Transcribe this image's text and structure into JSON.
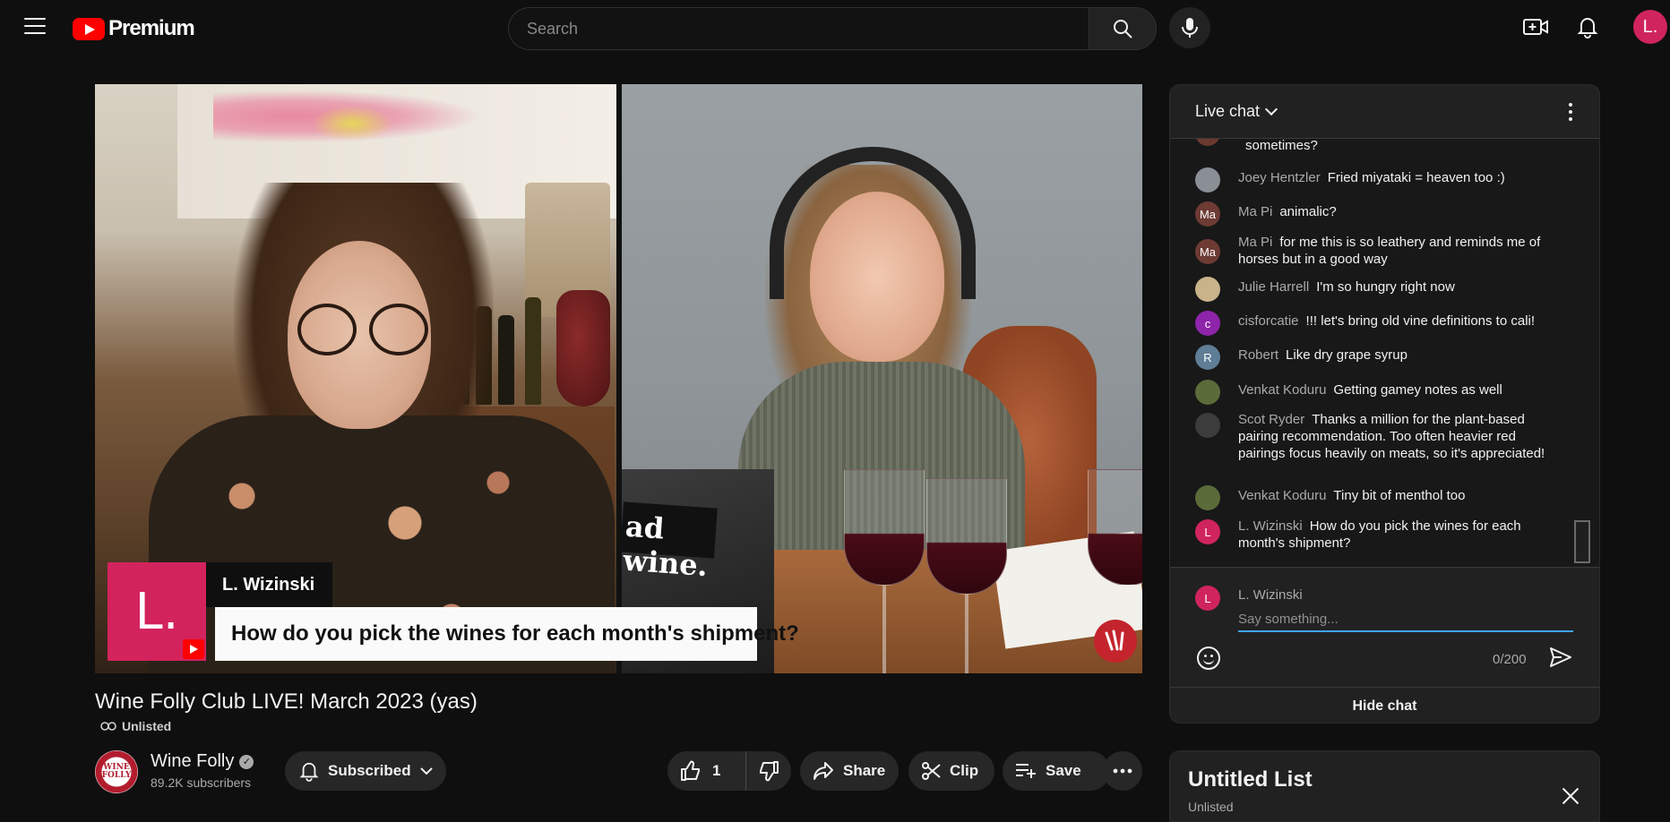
{
  "header": {
    "logo_text": "Premium",
    "search_placeholder": "Search",
    "avatar_letter": "L."
  },
  "video": {
    "lower_third_logo": "L.",
    "lower_third_name": "L. Wizinski",
    "lower_third_question": "How do you pick the wines for each month's shipment?",
    "laptop_sticker": "ad wine."
  },
  "info": {
    "title": "Wine Folly Club LIVE! March 2023 (yas)",
    "visibility": "Unlisted",
    "channel_name": "Wine Folly",
    "channel_logo_text": "WINE FOLLY",
    "subscribers": "89.2K subscribers",
    "subscribed_label": "Subscribed",
    "like_count": "1",
    "share_label": "Share",
    "clip_label": "Clip",
    "save_label": "Save"
  },
  "chat": {
    "header_title": "Live chat",
    "messages": [
      {
        "author": "",
        "text": "sometimes?",
        "avatar": "",
        "color": "#6b3a2e"
      },
      {
        "author": "Joey Hentzler",
        "text": "Fried miyataki = heaven too :)",
        "avatar": "",
        "color": "#8a8f96"
      },
      {
        "author": "Ma Pi",
        "text": "animalic?",
        "avatar": "Ma",
        "color": "#6d3b34"
      },
      {
        "author": "Ma Pi",
        "text": "for me this is so leathery and reminds me of horses but in a good way",
        "avatar": "Ma",
        "color": "#6d3b34"
      },
      {
        "author": "Julie Harrell",
        "text": "I'm so hungry right now",
        "avatar": "",
        "color": "#c9b38a"
      },
      {
        "author": "cisforcatie",
        "text": "!!! let's bring old vine definitions to cali!",
        "avatar": "c",
        "color": "#8e24aa"
      },
      {
        "author": "Robert",
        "text": "Like dry grape syrup",
        "avatar": "R",
        "color": "#5f7d95"
      },
      {
        "author": "Venkat Koduru",
        "text": "Getting gamey notes as well",
        "avatar": "",
        "color": "#5b6b3a"
      },
      {
        "author": "Scot Ryder",
        "text": "Thanks a million for the plant-based pairing recommendation. Too often heavier red pairings focus heavily on meats, so it's appreciated!",
        "avatar": "",
        "color": "#3c3c3c"
      },
      {
        "author": "Venkat Koduru",
        "text": "Tiny bit of menthol too",
        "avatar": "",
        "color": "#5b6b3a"
      },
      {
        "author": "L. Wizinski",
        "text": "How do you pick the wines for each month's shipment?",
        "avatar": "L",
        "color": "#d0245e"
      }
    ],
    "input_name": "L. Wizinski",
    "input_avatar": "L",
    "input_placeholder": "Say something...",
    "char_count": "0/200",
    "hide_chat_label": "Hide chat"
  },
  "playlist": {
    "title": "Untitled List",
    "subtitle": "Unlisted"
  }
}
